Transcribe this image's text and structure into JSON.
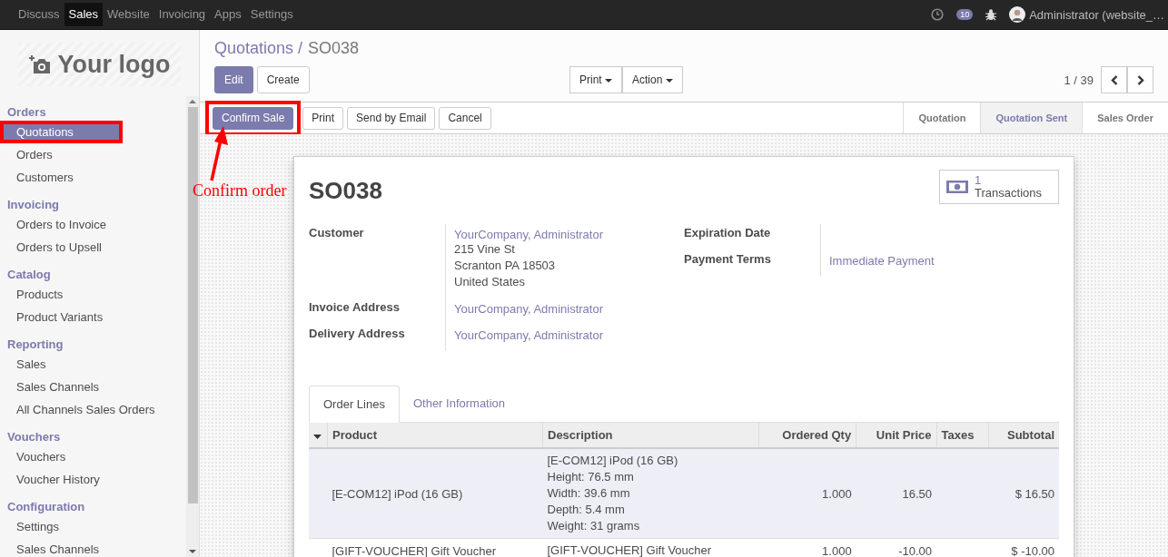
{
  "top_menu": [
    {
      "label": "Discuss",
      "selected": false
    },
    {
      "label": "Sales",
      "selected": true
    },
    {
      "label": "Website",
      "selected": false
    },
    {
      "label": "Invoicing",
      "selected": false
    },
    {
      "label": "Apps",
      "selected": false
    },
    {
      "label": "Settings",
      "selected": false
    }
  ],
  "systray": {
    "message_count": "10",
    "user": "Administrator (website_…"
  },
  "logo": "Your logo",
  "sidebar": {
    "sections": [
      {
        "title": "Orders",
        "items": [
          {
            "label": "Quotations",
            "selected": true,
            "highlighted": true
          },
          {
            "label": "Orders",
            "selected": false,
            "highlighted": false
          },
          {
            "label": "Customers",
            "selected": false,
            "highlighted": false
          }
        ]
      },
      {
        "title": "Invoicing",
        "items": [
          {
            "label": "Orders to Invoice",
            "selected": false,
            "highlighted": false
          },
          {
            "label": "Orders to Upsell",
            "selected": false,
            "highlighted": false
          }
        ]
      },
      {
        "title": "Catalog",
        "items": [
          {
            "label": "Products",
            "selected": false,
            "highlighted": false
          },
          {
            "label": "Product Variants",
            "selected": false,
            "highlighted": false
          }
        ]
      },
      {
        "title": "Reporting",
        "items": [
          {
            "label": "Sales",
            "selected": false,
            "highlighted": false
          },
          {
            "label": "Sales Channels",
            "selected": false,
            "highlighted": false
          },
          {
            "label": "All Channels Sales Orders",
            "selected": false,
            "highlighted": false
          }
        ]
      },
      {
        "title": "Vouchers",
        "items": [
          {
            "label": "Vouchers",
            "selected": false,
            "highlighted": false
          },
          {
            "label": "Voucher History",
            "selected": false,
            "highlighted": false
          }
        ]
      },
      {
        "title": "Configuration",
        "items": [
          {
            "label": "Settings",
            "selected": false,
            "highlighted": false
          },
          {
            "label": "Sales Channels",
            "selected": false,
            "highlighted": false
          }
        ]
      }
    ]
  },
  "breadcrumb": {
    "parent": "Quotations /",
    "current": "SO038"
  },
  "main_buttons": [
    {
      "label": "Edit",
      "kind": "primary"
    },
    {
      "label": "Create",
      "kind": "default"
    }
  ],
  "dropdowns": [
    "Print",
    "Action"
  ],
  "pager": "1 / 39",
  "action_buttons": [
    {
      "label": "Confirm Sale",
      "kind": "primary",
      "highlighted": true
    },
    {
      "label": "Print",
      "kind": "default",
      "highlighted": false
    },
    {
      "label": "Send by Email",
      "kind": "default",
      "highlighted": false
    },
    {
      "label": "Cancel",
      "kind": "default",
      "highlighted": false
    }
  ],
  "stages": [
    {
      "label": "Quotation",
      "selected": false
    },
    {
      "label": "Quotation Sent",
      "selected": true
    },
    {
      "label": "Sales Order",
      "selected": false
    }
  ],
  "annotation": {
    "label": "Confirm order"
  },
  "record": {
    "name": "SO038",
    "transactions": {
      "count": "1",
      "label": "Transactions"
    },
    "left_fields": [
      {
        "label": "Customer",
        "link": "YourCompany, Administrator",
        "lines": [
          "215 Vine St",
          "Scranton PA 18503",
          "United States"
        ]
      },
      {
        "label": "Invoice Address",
        "link": "YourCompany, Administrator"
      },
      {
        "label": "Delivery Address",
        "link": "YourCompany, Administrator"
      }
    ],
    "right_fields": [
      {
        "label": "Expiration Date"
      },
      {
        "label": "Payment Terms",
        "link": "Immediate Payment"
      }
    ]
  },
  "tabs": [
    {
      "label": "Order Lines",
      "selected": true
    },
    {
      "label": "Other Information",
      "selected": false
    }
  ],
  "table": {
    "columns": [
      "Product",
      "Description",
      "Ordered Qty",
      "Unit Price",
      "Taxes",
      "Subtotal"
    ],
    "rows": [
      {
        "selected": true,
        "product": "[E-COM12] iPod (16 GB)",
        "description": [
          "[E-COM12] iPod (16 GB)",
          "Height: 76.5 mm",
          "Width:  39.6 mm",
          "Depth:  5.4 mm",
          "Weight: 31 grams"
        ],
        "qty": "1.000",
        "price": "16.50",
        "subtotal": "$ 16.50"
      },
      {
        "selected": false,
        "product": "[GIFT-VOUCHER] Gift Voucher",
        "description": [
          "[GIFT-VOUCHER] Gift Voucher"
        ],
        "qty": "1.000",
        "price": "-10.00",
        "subtotal": "$ -10.00"
      }
    ]
  }
}
